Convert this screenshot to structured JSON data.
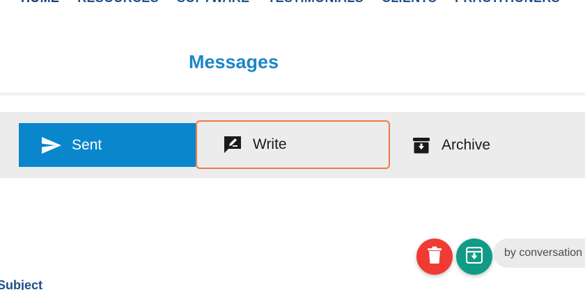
{
  "nav": {
    "items": [
      "HOME",
      "RESOURCES",
      "SOFTWARE",
      "TESTIMONIALS",
      "CLIENTS",
      "PRACTITIONERS"
    ]
  },
  "page": {
    "title": "Messages"
  },
  "tabs": {
    "sent": {
      "label": "Sent",
      "icon": "send-icon"
    },
    "write": {
      "label": "Write",
      "icon": "compose-icon"
    },
    "archive": {
      "label": "Archive",
      "icon": "archive-box-icon"
    }
  },
  "actions": {
    "delete_icon": "trash-icon",
    "archive_icon": "archive-icon",
    "filter_chip": "by conversation"
  },
  "form": {
    "subject_label": "Subject"
  },
  "colors": {
    "primary": "#0a86cc",
    "title": "#1b86c8",
    "nav": "#1b4f8a",
    "highlight_border": "#ee7b45",
    "danger": "#ef3b34",
    "teal": "#0f9b86"
  }
}
